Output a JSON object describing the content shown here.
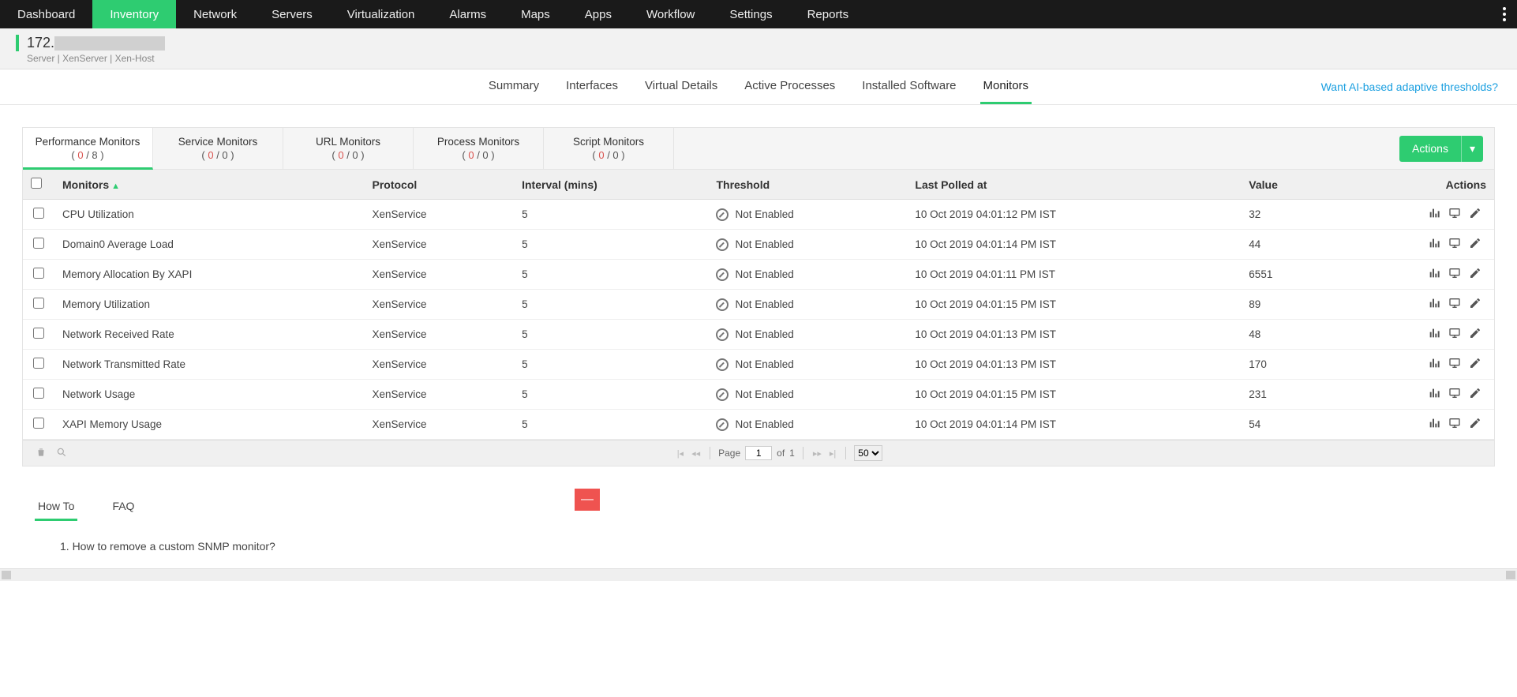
{
  "topnav": [
    "Dashboard",
    "Inventory",
    "Network",
    "Servers",
    "Virtualization",
    "Alarms",
    "Maps",
    "Apps",
    "Workflow",
    "Settings",
    "Reports"
  ],
  "topnav_active": "Inventory",
  "header": {
    "ip_prefix": "172.",
    "breadcrumb": "Server  | XenServer  | Xen-Host"
  },
  "subtabs": [
    "Summary",
    "Interfaces",
    "Virtual Details",
    "Active Processes",
    "Installed Software",
    "Monitors"
  ],
  "subtab_active": "Monitors",
  "ai_link": "Want AI-based adaptive thresholds?",
  "monitor_tabs": [
    {
      "title": "Performance Monitors",
      "count_left": "0",
      "count_right": "8"
    },
    {
      "title": "Service Monitors",
      "count_left": "0",
      "count_right": "0"
    },
    {
      "title": "URL Monitors",
      "count_left": "0",
      "count_right": "0"
    },
    {
      "title": "Process Monitors",
      "count_left": "0",
      "count_right": "0"
    },
    {
      "title": "Script Monitors",
      "count_left": "0",
      "count_right": "0"
    }
  ],
  "monitor_tab_active": 0,
  "actions_label": "Actions",
  "columns": {
    "monitors": "Monitors",
    "protocol": "Protocol",
    "interval": "Interval (mins)",
    "threshold": "Threshold",
    "last_polled": "Last Polled at",
    "value": "Value",
    "actions": "Actions"
  },
  "threshold_text": "Not Enabled",
  "rows": [
    {
      "name": "CPU Utilization",
      "protocol": "XenService",
      "interval": "5",
      "polled": "10 Oct 2019 04:01:12 PM IST",
      "value": "32"
    },
    {
      "name": "Domain0 Average Load",
      "protocol": "XenService",
      "interval": "5",
      "polled": "10 Oct 2019 04:01:14 PM IST",
      "value": "44"
    },
    {
      "name": "Memory Allocation By XAPI",
      "protocol": "XenService",
      "interval": "5",
      "polled": "10 Oct 2019 04:01:11 PM IST",
      "value": "6551"
    },
    {
      "name": "Memory Utilization",
      "protocol": "XenService",
      "interval": "5",
      "polled": "10 Oct 2019 04:01:15 PM IST",
      "value": "89"
    },
    {
      "name": "Network Received Rate",
      "protocol": "XenService",
      "interval": "5",
      "polled": "10 Oct 2019 04:01:13 PM IST",
      "value": "48"
    },
    {
      "name": "Network Transmitted Rate",
      "protocol": "XenService",
      "interval": "5",
      "polled": "10 Oct 2019 04:01:13 PM IST",
      "value": "170"
    },
    {
      "name": "Network Usage",
      "protocol": "XenService",
      "interval": "5",
      "polled": "10 Oct 2019 04:01:15 PM IST",
      "value": "231"
    },
    {
      "name": "XAPI Memory Usage",
      "protocol": "XenService",
      "interval": "5",
      "polled": "10 Oct 2019 04:01:14 PM IST",
      "value": "54"
    }
  ],
  "pager": {
    "page_label": "Page",
    "page": "1",
    "of": "of",
    "total": "1",
    "size": "50"
  },
  "howto": {
    "tabs": [
      "How To",
      "FAQ"
    ],
    "active": 0,
    "item1": "1. How to remove a custom SNMP monitor?",
    "redbox": "—"
  }
}
